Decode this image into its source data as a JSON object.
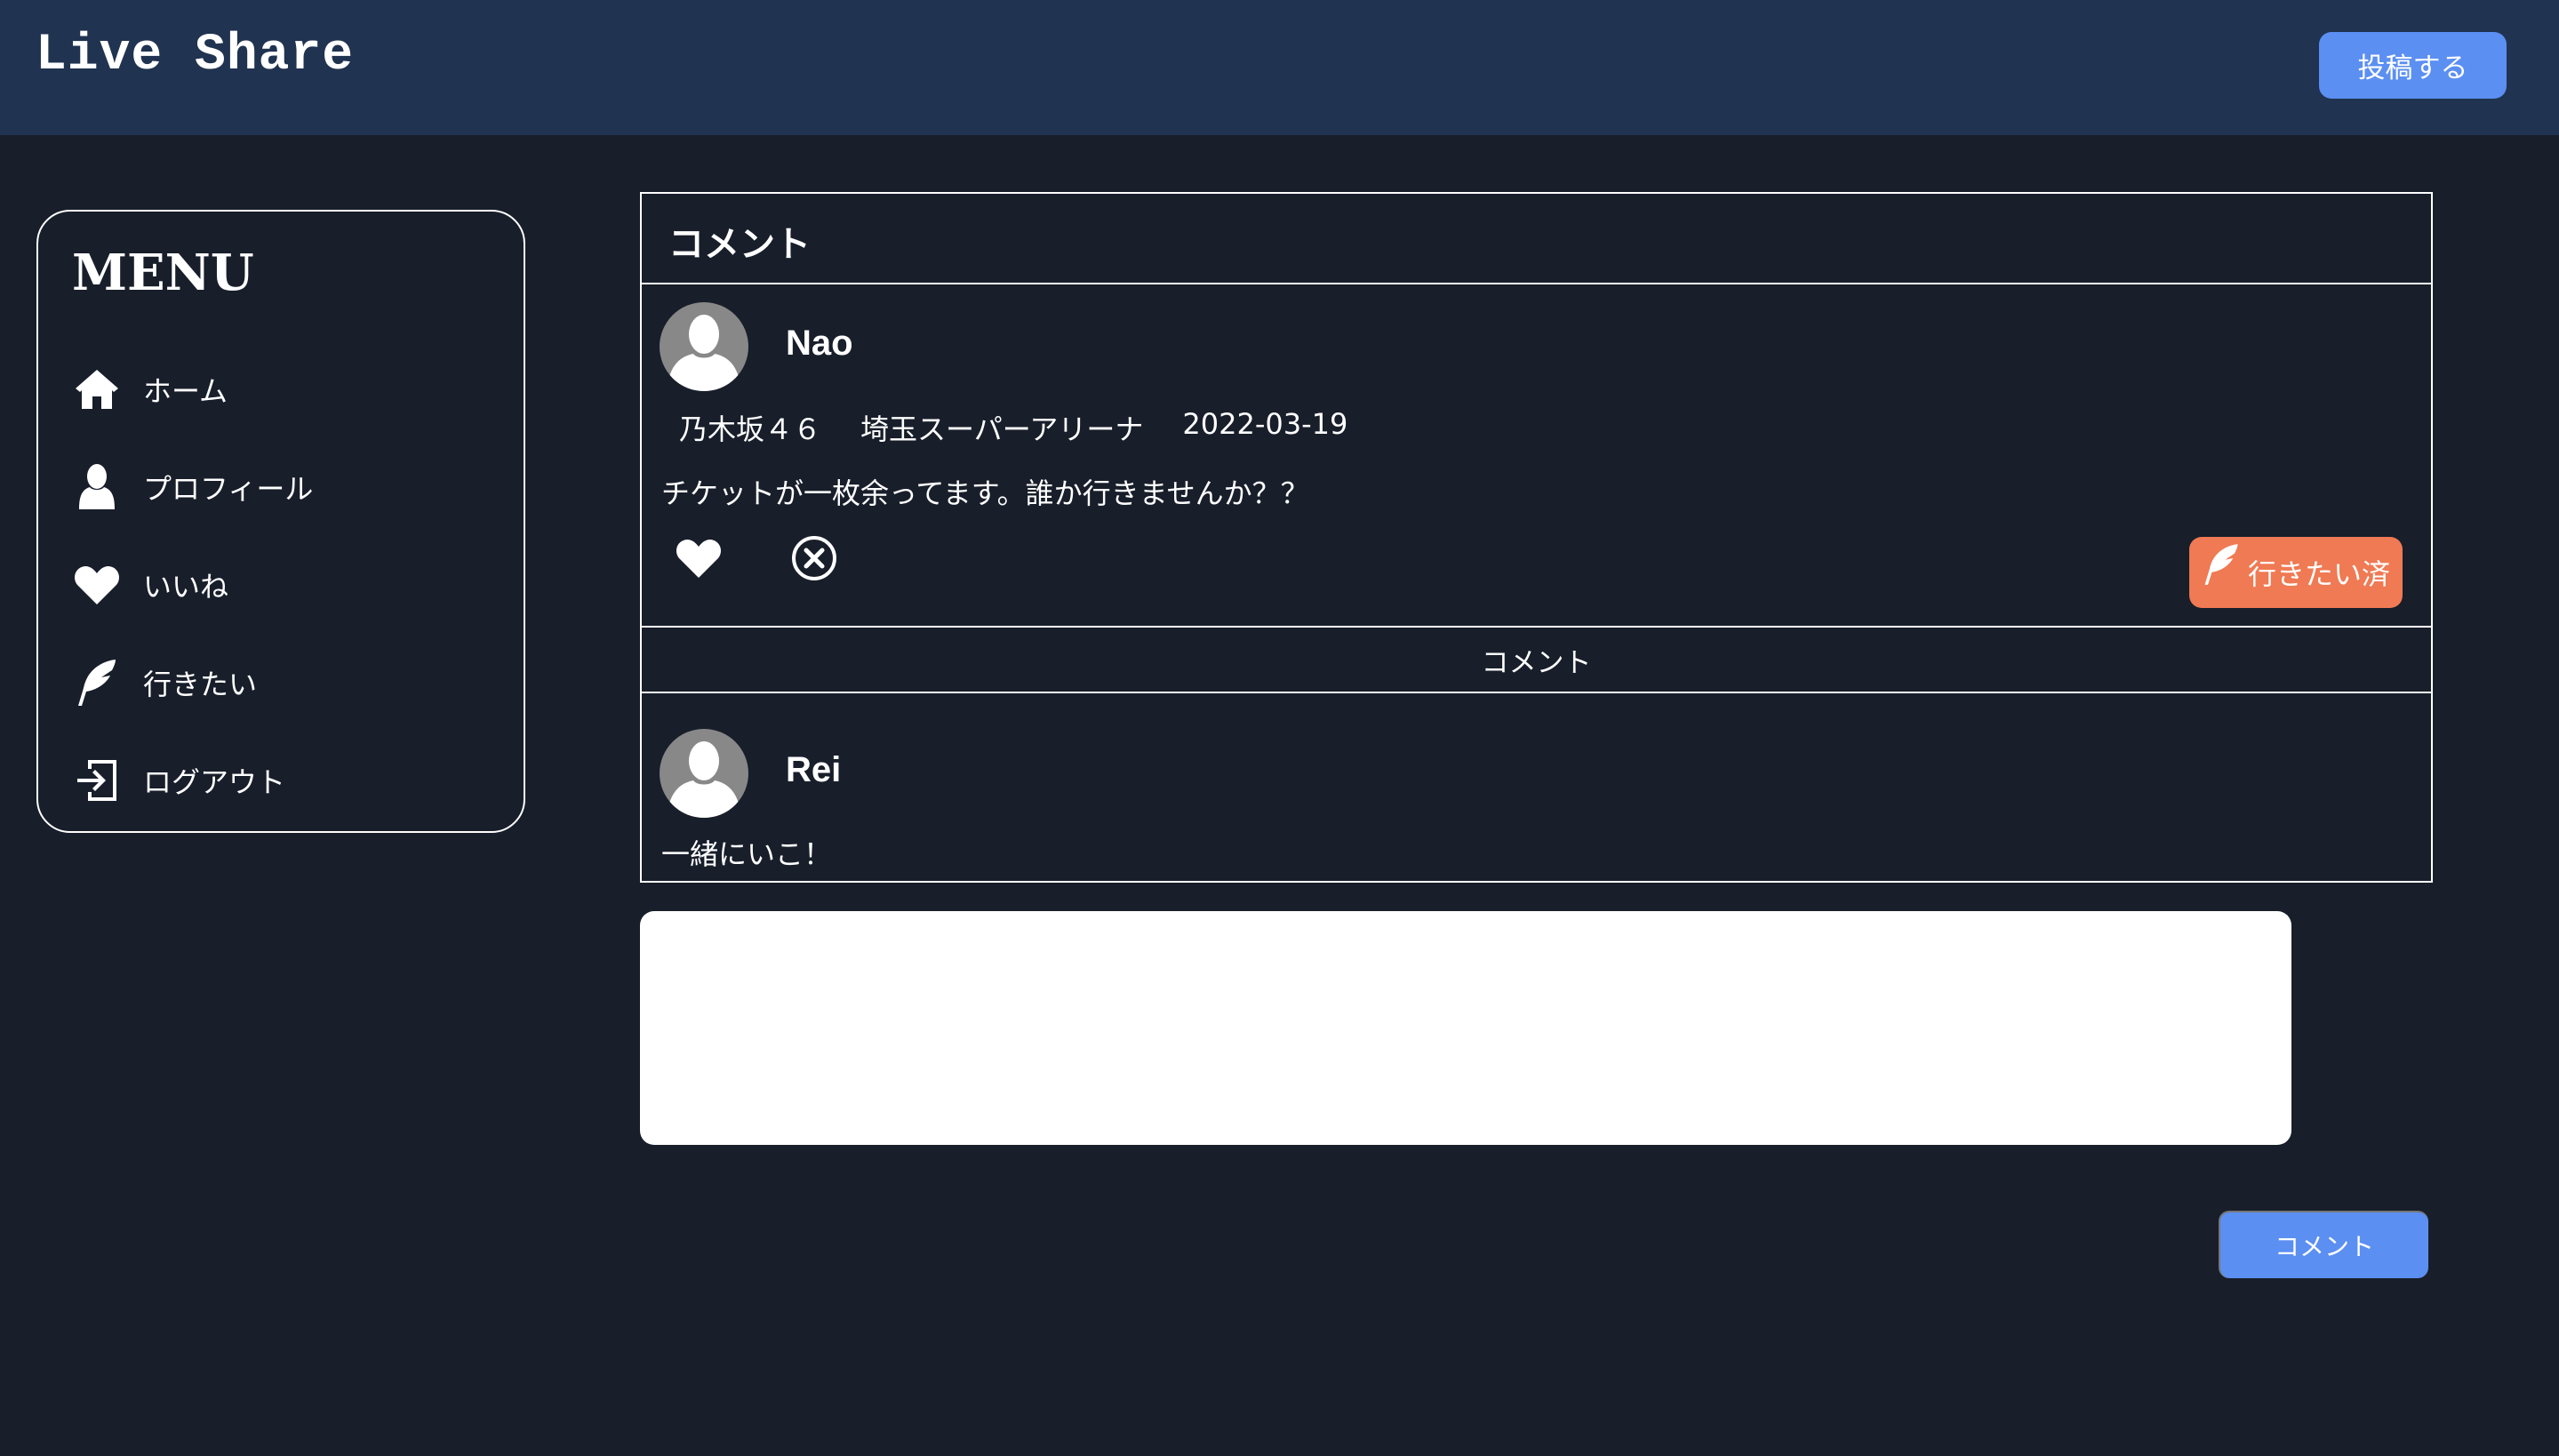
{
  "header": {
    "logo": "Live Share",
    "post_button": "投稿する"
  },
  "sidebar": {
    "title": "MENU",
    "items": [
      {
        "label": "ホーム",
        "icon": "home-icon"
      },
      {
        "label": "プロフィール",
        "icon": "user-icon"
      },
      {
        "label": "いいね",
        "icon": "heart-icon"
      },
      {
        "label": "行きたい",
        "icon": "feather-icon"
      },
      {
        "label": "ログアウト",
        "icon": "logout-icon"
      }
    ]
  },
  "card": {
    "title": "コメント",
    "post": {
      "user": "Nao",
      "artist": "乃木坂４６",
      "venue": "埼玉スーパーアリーナ",
      "date": "2022-03-19",
      "text": "チケットが一枚余ってます。誰か行きませんか？？",
      "want_button": "行きたい済"
    },
    "comments_label": "コメント",
    "comments": [
      {
        "user": "Rei",
        "text": "一緒にいこ！"
      }
    ]
  },
  "form": {
    "textarea_value": "",
    "submit_label": "コメント"
  },
  "colors": {
    "background": "#181e2a",
    "header": "#203350",
    "primary_button": "#5b8ff2",
    "want_button": "#ef7a53"
  }
}
